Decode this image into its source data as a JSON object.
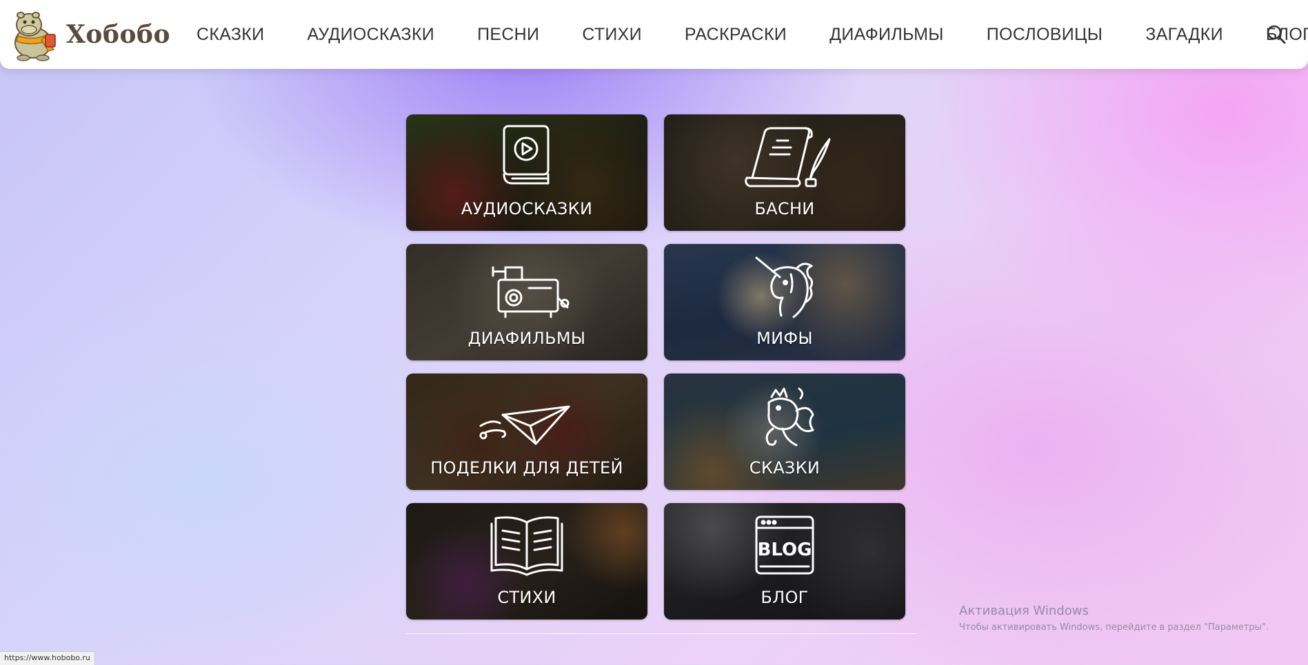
{
  "header": {
    "logo_text": "Хобобо",
    "nav": [
      {
        "label": "СКАЗКИ"
      },
      {
        "label": "АУДИОСКАЗКИ"
      },
      {
        "label": "ПЕСНИ"
      },
      {
        "label": "СТИХИ"
      },
      {
        "label": "РАСКРАСКИ"
      },
      {
        "label": "ДИАФИЛЬМЫ"
      },
      {
        "label": "ПОСЛОВИЦЫ"
      },
      {
        "label": "ЗАГАДКИ"
      },
      {
        "label": "БЛОГ"
      }
    ],
    "search_icon": "search-icon"
  },
  "tiles": [
    {
      "label": "АУДИОСКАЗКИ",
      "icon": "play-book-icon"
    },
    {
      "label": "БАСНИ",
      "icon": "scroll-quill-icon"
    },
    {
      "label": "ДИАФИЛЬМЫ",
      "icon": "projector-icon"
    },
    {
      "label": "МИФЫ",
      "icon": "unicorn-icon"
    },
    {
      "label": "ПОДЕЛКИ ДЛЯ ДЕТЕЙ",
      "icon": "paper-plane-icon"
    },
    {
      "label": "СКАЗКИ",
      "icon": "goldfish-icon"
    },
    {
      "label": "СТИХИ",
      "icon": "open-book-icon"
    },
    {
      "label": "БЛОГ",
      "icon": "blog-window-icon"
    }
  ],
  "blog_icon_text": "BLOG",
  "watermark": {
    "title": "Активация Windows",
    "subtitle": "Чтобы активировать Windows, перейдите в раздел \"Параметры\"."
  },
  "status_url": "https://www.hobobo.ru",
  "colors": {
    "header_bg": "#ffffff",
    "logo_text": "#5c4a3e",
    "nav_text": "#333333",
    "tile_label": "#ffffff"
  }
}
